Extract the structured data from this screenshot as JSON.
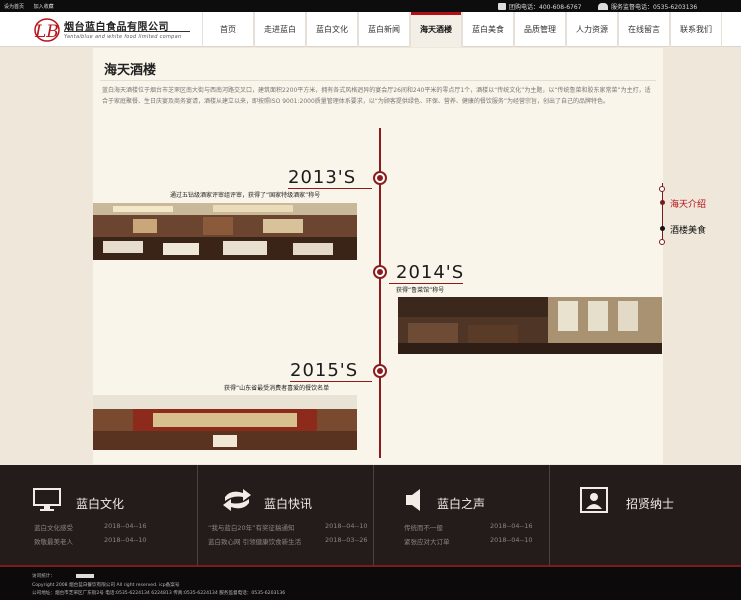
{
  "topbar": {
    "links": [
      "设为首页",
      "加入收藏"
    ],
    "order_phone": "团购电话：400-608-6767",
    "service_phone": "服务监督电话：0535-6203136"
  },
  "logo": {
    "cn": "烟台蓝白食品有限公司",
    "en": "Yantaiblue and white food limited compan",
    "mark": "LB"
  },
  "nav": {
    "items": [
      "首页",
      "走进蓝白",
      "蓝白文化",
      "蓝白新闻",
      "海天酒楼",
      "蓝白美食",
      "品质管理",
      "人力资源",
      "在线留言",
      "联系我们"
    ],
    "active_index": 4
  },
  "page": {
    "title": "海天酒楼",
    "intro": "蓝白海天酒楼位于烟台市芝罘区南大街与西南河路交叉口，建筑面积2200平方米，拥有各式风格迥异的宴会厅26间和240平米的零点厅1个，酒楼以“传统文化”为主题，以“传统鲁菜和胶东家常菜”为主打，适合于家庭聚餐、生日庆宴及商务宴请，酒楼从建立以来，即按照ISO 9001:2000质量管理体系要求，以“为顾客提供绿色、环保、营养、健康的餐饮服务”为经营宗旨，创出了自己的品牌特色。"
  },
  "timeline": [
    {
      "year": "2013'S",
      "desc": "通过五钻级酒家评审组评审，获得了“国家特级酒家”称号"
    },
    {
      "year": "2014'S",
      "desc": "获得“鲁菜馆”称号"
    },
    {
      "year": "2015'S",
      "desc": "获得“山东省最受消费者喜爱的餐饮名单"
    }
  ],
  "side_nav": {
    "items": [
      "海天介绍",
      "酒楼美食"
    ],
    "active_index": 0
  },
  "footer": {
    "columns": [
      {
        "title": "蓝白文化",
        "icon": "monitor-icon",
        "rows": [
          {
            "text": "蓝白文化感受",
            "date": "2018--04--16"
          },
          {
            "text": "致敬最美老人",
            "date": "2018--04--10"
          }
        ]
      },
      {
        "title": "蓝白快讯",
        "icon": "exchange-arrows-icon",
        "rows": [
          {
            "text": "“我与蓝白20年”有奖征稿通知",
            "date": "2018--04--10"
          },
          {
            "text": "蓝白致心网 引领健康饮食新生活",
            "date": "2018--03--26"
          }
        ]
      },
      {
        "title": "蓝白之声",
        "icon": "speaker-icon",
        "rows": [
          {
            "text": "传统而不一般",
            "date": "2018--04--16"
          },
          {
            "text": "紧张应对大订单",
            "date": "2018--04--10"
          }
        ]
      },
      {
        "title": "招贤纳士",
        "icon": "person-card-icon",
        "rows": []
      }
    ]
  },
  "bottom": {
    "visits_label": "访问统计：",
    "copyright": "Copyright 2008 烟台蓝白餐饮有限公司 All right reserved. icp备案号",
    "address": "公司地址：烟台市芝罘区广东街2号 电话:0535-6224134 6224813 传真:0535-6224134 服务监督电话：0535-6203136"
  },
  "colors": {
    "accent": "#8c1c1c",
    "footer_bg": "#231c1a",
    "panel_bg": "#faf5ea"
  }
}
